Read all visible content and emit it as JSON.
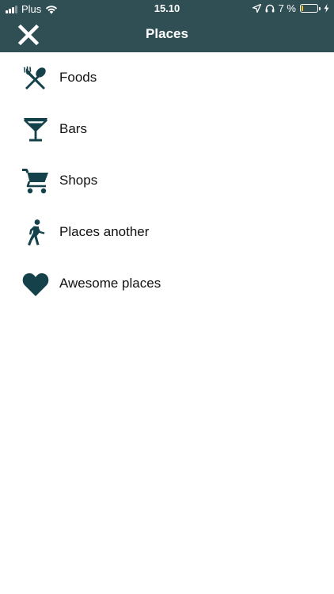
{
  "status_bar": {
    "carrier": "Plus",
    "time": "15.10",
    "battery_text": "7 %",
    "battery_level": 0.07,
    "icons": [
      "signal-icon",
      "wifi-icon",
      "location-arrow-icon",
      "headphones-icon",
      "battery-icon",
      "charging-bolt-icon"
    ]
  },
  "header": {
    "title": "Places",
    "close_icon": "close-icon"
  },
  "places": [
    {
      "label": "Foods",
      "icon": "fork-spoon-icon"
    },
    {
      "label": "Bars",
      "icon": "cocktail-glass-icon"
    },
    {
      "label": "Shops",
      "icon": "shopping-cart-icon"
    },
    {
      "label": "Places another",
      "icon": "walking-person-icon"
    },
    {
      "label": "Awesome places",
      "icon": "heart-icon"
    }
  ],
  "colors": {
    "header_bg": "#2f4f55",
    "icon": "#14414a",
    "battery_low": "#f2c014"
  }
}
